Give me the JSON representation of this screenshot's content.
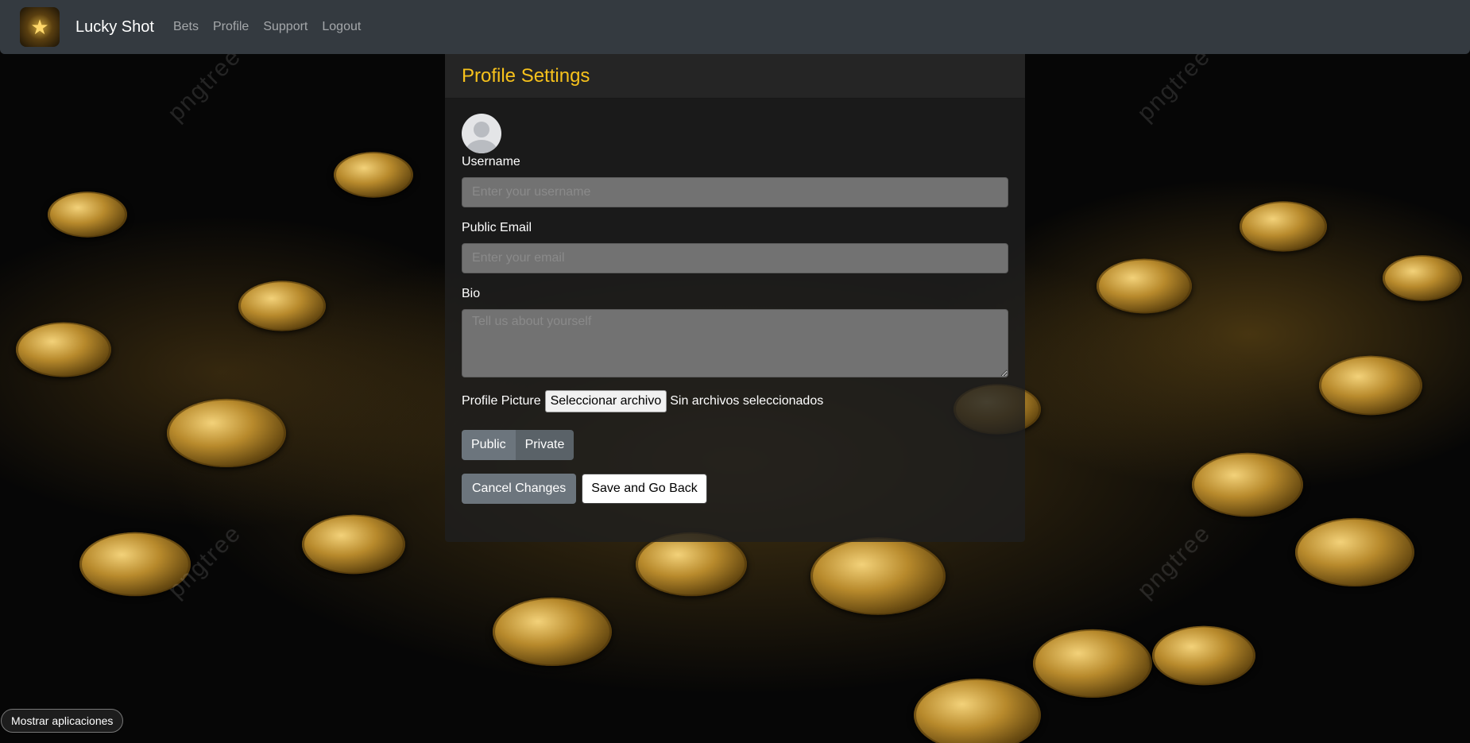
{
  "navbar": {
    "brand_name": "Lucky Shot",
    "links": [
      "Bets",
      "Profile",
      "Support",
      "Logout"
    ]
  },
  "card": {
    "title": "Profile Settings",
    "username_label": "Username",
    "username_placeholder": "Enter your username",
    "email_label": "Public Email",
    "email_placeholder": "Enter your email",
    "bio_label": "Bio",
    "bio_placeholder": "Tell us about yourself",
    "picture_label": "Profile Picture",
    "file_button": "Seleccionar archivo",
    "file_status": "Sin archivos seleccionados",
    "visibility": {
      "public_label": "Public",
      "private_label": "Private"
    },
    "cancel_label": "Cancel Changes",
    "save_label": "Save and Go Back"
  },
  "footer": {
    "apps_button": "Mostrar aplicaciones"
  },
  "colors": {
    "accent": "#f7c21c",
    "navbar": "#343a40",
    "secondary": "#6c757d"
  }
}
